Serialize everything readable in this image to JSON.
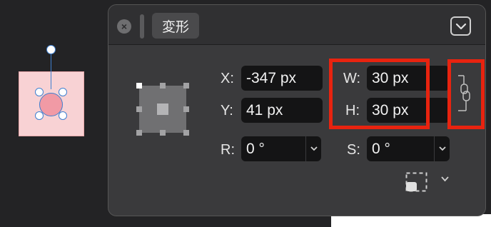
{
  "panel": {
    "title_tab": "変形",
    "fields": {
      "x": {
        "label": "X:",
        "value": "-347 px"
      },
      "y": {
        "label": "Y:",
        "value": "41 px"
      },
      "w": {
        "label": "W:",
        "value": "30 px"
      },
      "h": {
        "label": "H:",
        "value": "30 px"
      },
      "r": {
        "label": "R:",
        "value": "0 °"
      },
      "s": {
        "label": "S:",
        "value": "0 °"
      }
    }
  },
  "icons": {
    "close": "close-icon",
    "collapse": "chevron-down-icon",
    "link": "link-proportions-icon",
    "origin": "transform-origin-icon"
  },
  "colors": {
    "highlight": "#e8230f",
    "selection": "#3e7fd0",
    "shape_fill": "#f19aa5",
    "shape_bg": "#f8d2d4"
  }
}
